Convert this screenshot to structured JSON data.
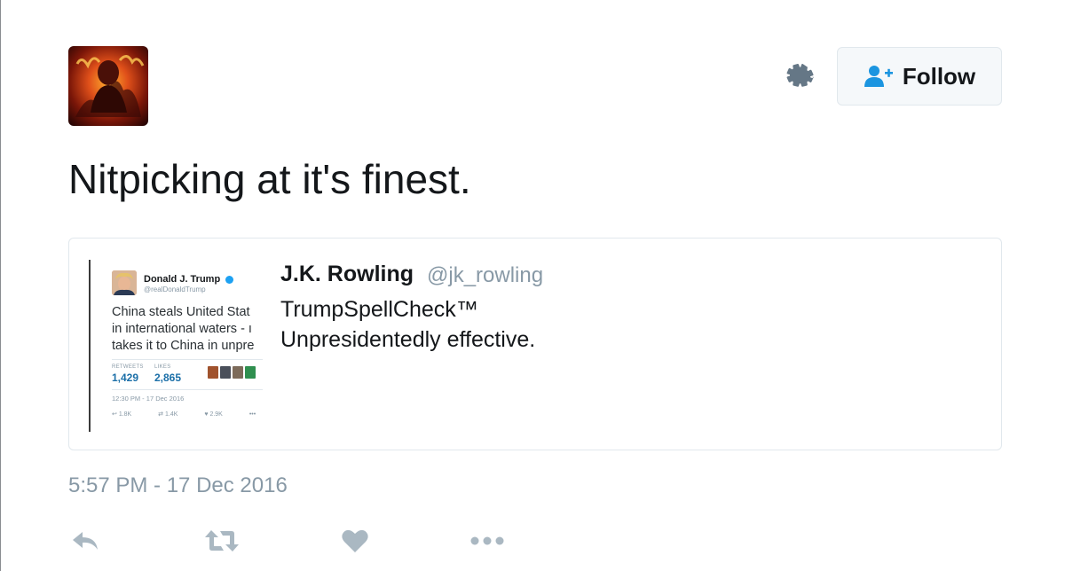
{
  "account": {
    "avatar_icon": "avatar-image"
  },
  "header": {
    "settings_icon": "gear-icon",
    "follow_icon": "follow-person-plus-icon",
    "follow_label": "Follow"
  },
  "tweet": {
    "text": "Nitpicking at it's finest.",
    "timestamp": "5:57 PM - 17 Dec 2016"
  },
  "quoted_tweet": {
    "author_name": "J.K. Rowling",
    "author_handle": "@jk_rowling",
    "text_line1": "TrumpSpellCheck™",
    "text_line2": "Unpresidentedly effective.",
    "media": {
      "name": "Donald J. Trump",
      "handle": "@realDonaldTrump",
      "text_line1": "China steals United Stat",
      "text_line2": "in international waters - ı",
      "text_line3": "takes it to China in unpre",
      "retweets_label": "RETWEETS",
      "retweets_value": "1,429",
      "likes_label": "LIKES",
      "likes_value": "2,865",
      "time": "12:30 PM - 17 Dec 2016",
      "reply_count": "1.8K",
      "retweet_count": "1.4K",
      "like_count": "2.9K",
      "more": "•••"
    }
  },
  "actions": {
    "reply_icon": "reply-icon",
    "retweet_icon": "retweet-icon",
    "like_icon": "heart-icon",
    "more_icon": "more-dots-icon"
  },
  "colors": {
    "icon_gray": "#aab8c2",
    "text_gray": "#8899a6",
    "accent_blue": "#1da1f2",
    "follow_icon_blue": "#1b95e0"
  }
}
